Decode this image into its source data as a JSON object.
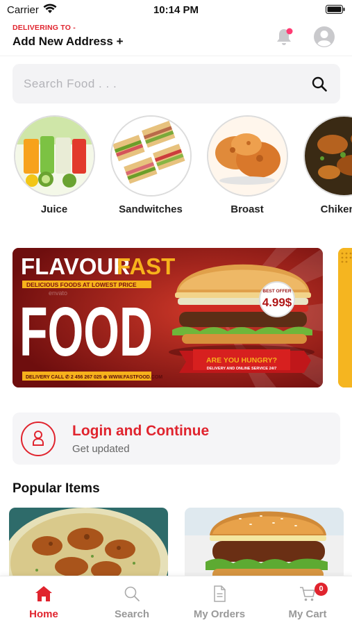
{
  "status_bar": {
    "carrier": "Carrier",
    "time": "10:14 PM"
  },
  "header": {
    "delivering_label": "DELIVERING TO -",
    "address": "Add New Address +"
  },
  "search": {
    "placeholder": "Search Food . . ."
  },
  "categories": [
    {
      "label": "Juice",
      "icon": "juice-image"
    },
    {
      "label": "Sandwitches",
      "icon": "sandwich-image"
    },
    {
      "label": "Broast",
      "icon": "broast-image"
    },
    {
      "label": "Chiken M",
      "icon": "chicken-image"
    }
  ],
  "banner": {
    "title_part1": "FLAVOUR",
    "title_part2": "FAST",
    "tagline": "DELICIOUS FOODS AT LOWEST PRICE",
    "big_word": "FOOD",
    "offer_label": "BEST OFFER",
    "offer_price": "4.99$",
    "cta": "ARE YOU HUNGRY?",
    "cta_sub": "DELIVERY AND ONLINE SERVICE 24/7",
    "contact": "DELIVERY CALL ✆ 2 456 267 025 ⊕ WWW.FASTFOOD.COM",
    "watermark": "envato"
  },
  "login_card": {
    "title": "Login and Continue",
    "subtitle": "Get updated"
  },
  "popular": {
    "title": "Popular Items"
  },
  "tabs": [
    {
      "label": "Home",
      "icon": "home-icon",
      "active": true
    },
    {
      "label": "Search",
      "icon": "search-icon",
      "active": false
    },
    {
      "label": "My Orders",
      "icon": "orders-icon",
      "active": false
    },
    {
      "label": "My Cart",
      "icon": "cart-icon",
      "active": false,
      "badge": "0"
    }
  ],
  "colors": {
    "accent": "#e0242e",
    "muted": "#999999"
  }
}
